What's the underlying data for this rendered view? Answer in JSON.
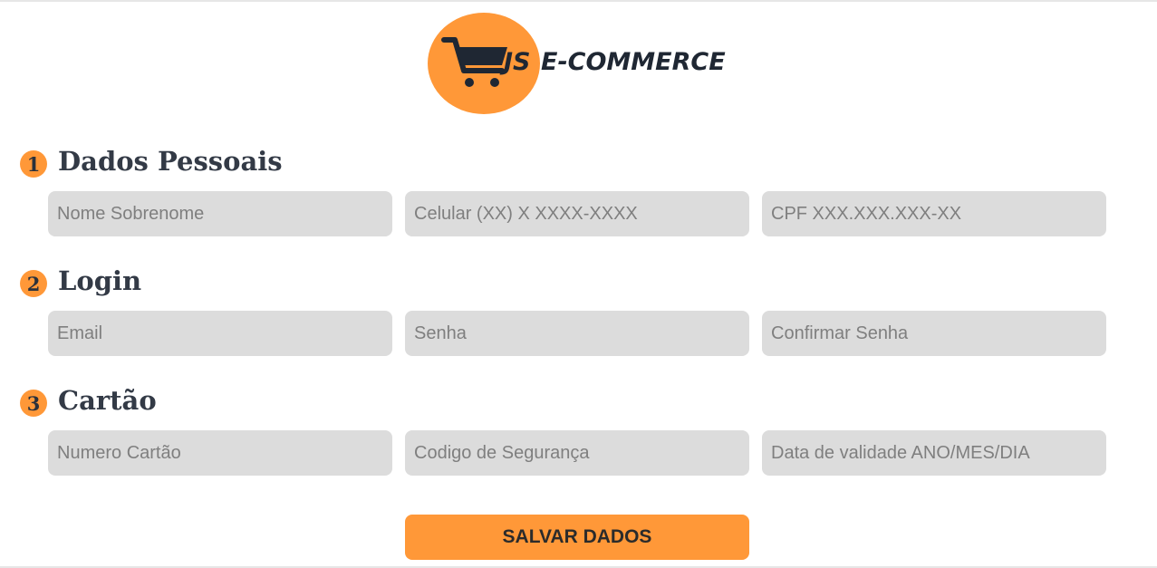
{
  "brand": {
    "logo_prefix": "JS",
    "logo_name": "E-COMMERCE",
    "accent_color": "#ff9838",
    "dark_color": "#1f2733",
    "logo_icon": "shopping-cart-icon"
  },
  "sections": [
    {
      "number": "1",
      "title": "Dados Pessoais",
      "fields": [
        {
          "placeholder": "Nome Sobrenome",
          "value": ""
        },
        {
          "placeholder": "Celular (XX) X XXXX-XXXX",
          "value": ""
        },
        {
          "placeholder": "CPF XXX.XXX.XXX-XX",
          "value": ""
        }
      ]
    },
    {
      "number": "2",
      "title": "Login",
      "fields": [
        {
          "placeholder": "Email",
          "value": ""
        },
        {
          "placeholder": "Senha",
          "value": ""
        },
        {
          "placeholder": "Confirmar Senha",
          "value": ""
        }
      ]
    },
    {
      "number": "3",
      "title": "Cartão",
      "fields": [
        {
          "placeholder": "Numero Cartão",
          "value": ""
        },
        {
          "placeholder": "Codigo de Segurança",
          "value": ""
        },
        {
          "placeholder": "Data de validade ANO/MES/DIA",
          "value": ""
        }
      ]
    }
  ],
  "actions": {
    "save_label": "SALVAR DADOS"
  }
}
